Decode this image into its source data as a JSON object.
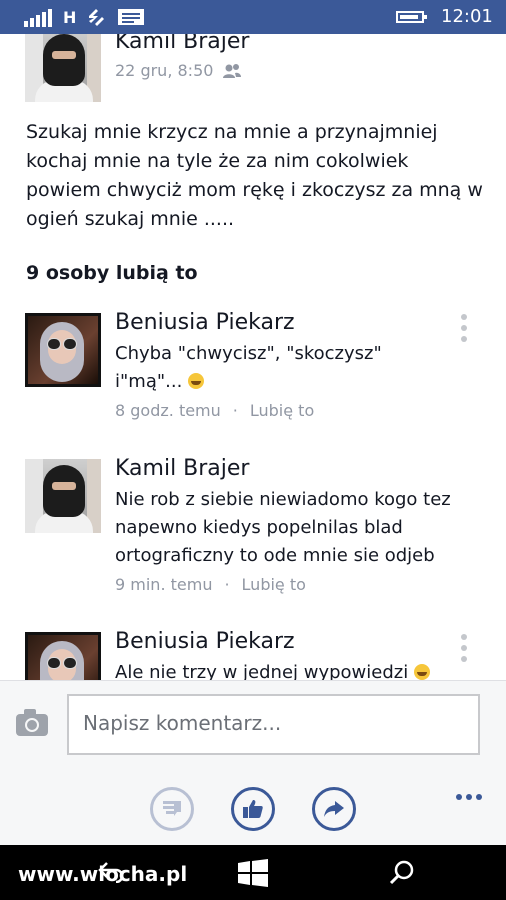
{
  "status_bar": {
    "network_type": "H",
    "time": "12:01",
    "icons": [
      "signal-icon",
      "data-transfer-icon",
      "message-icon",
      "battery-icon"
    ]
  },
  "post": {
    "author": "Kamil Brajer",
    "timestamp": "22 gru, 8:50",
    "audience_icon": "friends-icon",
    "text": "Szukaj mnie krzycz na mnie a przynajmniej kochaj mnie na tyle że za nim cokolwiek powiem chwyciż mom rękę i zkoczysz za mną w ogień szukaj mnie .....",
    "likes": "9 osoby lubią to"
  },
  "comments": [
    {
      "author": "Beniusia Piekarz",
      "text": "Chyba \"chwycisz\", \"skoczysz\" i\"mą\"...",
      "time": "8 godz. temu",
      "like_label": "Lubię to"
    },
    {
      "author": "Kamil Brajer",
      "text": "Nie rob z siebie niewiadomo kogo tez napewno kiedys popelnilas blad ortograficzny to ode mnie sie odjeb",
      "time": "9 min. temu",
      "like_label": "Lubię to"
    },
    {
      "author": "Beniusia Piekarz",
      "text": "Ale nie trzy w jednej wypowiedzi"
    }
  ],
  "comment_bar": {
    "placeholder": "Napisz komentarz..."
  },
  "watermark": "www.wiocha.pl",
  "colors": {
    "brand": "#3b5998",
    "meta_text": "#9197a3",
    "nav_background": "#000000"
  }
}
